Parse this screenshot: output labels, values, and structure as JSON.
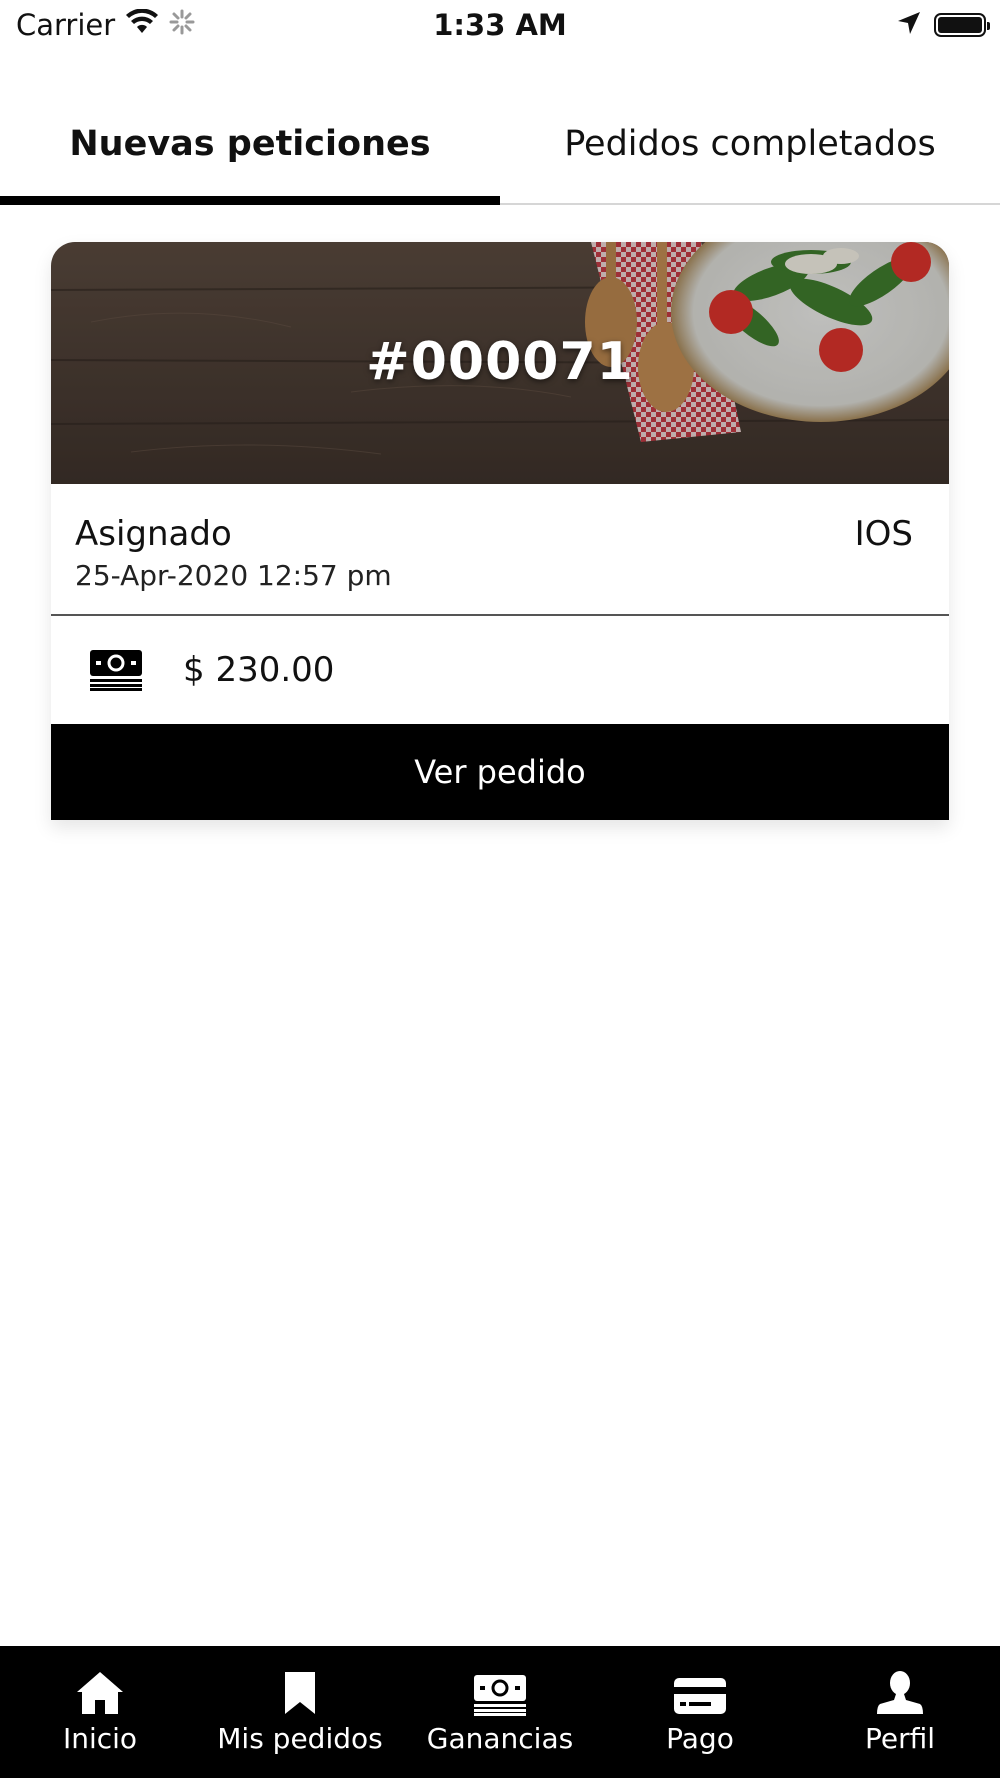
{
  "status_bar": {
    "carrier": "Carrier",
    "time": "1:33 AM"
  },
  "tabs": [
    {
      "label": "Nuevas peticiones",
      "active": true
    },
    {
      "label": "Pedidos completados",
      "active": false
    }
  ],
  "order_card": {
    "order_number": "#000071",
    "status": "Asignado",
    "platform": "IOS",
    "date": "25-Apr-2020 12:57 pm",
    "amount": "$ 230.00",
    "amount_icon": "money-icon",
    "button_label": "Ver pedido"
  },
  "bottom_nav": [
    {
      "label": "Inicio",
      "icon": "home-icon"
    },
    {
      "label": "Mis pedidos",
      "icon": "bookmark-icon"
    },
    {
      "label": "Ganancias",
      "icon": "money-icon"
    },
    {
      "label": "Pago",
      "icon": "credit-card-icon"
    },
    {
      "label": "Perfil",
      "icon": "person-icon"
    }
  ],
  "colors": {
    "primary": "#000000",
    "background": "#ffffff",
    "tab_divider": "#d6d6d6"
  }
}
